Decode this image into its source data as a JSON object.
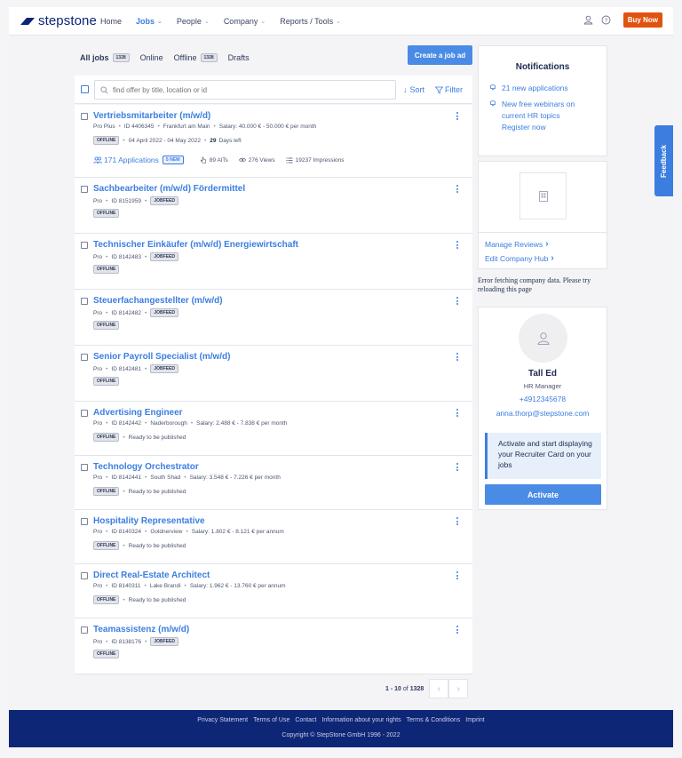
{
  "header": {
    "logo_text": "stepstone",
    "nav": [
      {
        "label": "Home",
        "dropdown": false,
        "active": false
      },
      {
        "label": "Jobs",
        "dropdown": true,
        "active": true
      },
      {
        "label": "People",
        "dropdown": true,
        "active": false
      },
      {
        "label": "Company",
        "dropdown": true,
        "active": false
      },
      {
        "label": "Reports / Tools",
        "dropdown": true,
        "active": false
      }
    ],
    "buy_label": "Buy Now",
    "accent": "#3b7ee0",
    "buy_color": "#e0530f"
  },
  "tabs": [
    {
      "label": "All jobs",
      "count": "1328",
      "active": true
    },
    {
      "label": "Online",
      "count": null,
      "active": false
    },
    {
      "label": "Offline",
      "count": "1328",
      "active": false
    },
    {
      "label": "Drafts",
      "count": null,
      "active": false
    }
  ],
  "create_label": "Create a job ad",
  "search": {
    "placeholder": "find offer by title, location or id",
    "sort_label": "Sort",
    "filter_label": "Filter"
  },
  "jobs": [
    {
      "title": "Vertriebsmitarbeiter (m/w/d)",
      "meta": [
        "Pro Plus",
        "ID 4406345",
        "Frankfurt am Main",
        "Salary: 40.000 € - 50.000 € per month"
      ],
      "badge": null,
      "status_pill": "OFFLINE",
      "status_text": "04 April 2022 - 04 May 2022",
      "days_bold": "29",
      "days_text": "Days left",
      "applications": "171 Applications",
      "new_pill": "5 NEW",
      "alts": "89 AlTs",
      "views": "276 Views",
      "impressions": "19237 Impressions"
    },
    {
      "title": "Sachbearbeiter (m/w/d) Fördermittel",
      "meta": [
        "Pro",
        "ID 8151959"
      ],
      "badge": "JOBFEED",
      "status_pill": "OFFLINE",
      "status_text": ""
    },
    {
      "title": "Technischer Einkäufer (m/w/d) Energiewirtschaft",
      "meta": [
        "Pro",
        "ID 8142483"
      ],
      "badge": "JOBFEED",
      "status_pill": "OFFLINE",
      "status_text": ""
    },
    {
      "title": "Steuerfachangestellter (m/w/d)",
      "meta": [
        "Pro",
        "ID 8142482"
      ],
      "badge": "JOBFEED",
      "status_pill": "OFFLINE",
      "status_text": ""
    },
    {
      "title": "Senior Payroll Specialist (m/w/d)",
      "meta": [
        "Pro",
        "ID 8142481"
      ],
      "badge": "JOBFEED",
      "status_pill": "OFFLINE",
      "status_text": ""
    },
    {
      "title": "Advertising Engineer",
      "meta": [
        "Pro",
        "ID 8142442",
        "Naderborough",
        "Salary: 2.488 € - 7.838 € per month"
      ],
      "badge": null,
      "status_pill": "OFFLINE",
      "status_text": "Ready to be published"
    },
    {
      "title": "Technology Orchestrator",
      "meta": [
        "Pro",
        "ID 8142441",
        "South Shad",
        "Salary: 3.548 € - 7.226 € per month"
      ],
      "badge": null,
      "status_pill": "OFFLINE",
      "status_text": "Ready to be published"
    },
    {
      "title": "Hospitality Representative",
      "meta": [
        "Pro",
        "ID 8140324",
        "Goldnerview",
        "Salary: 1.802 € - 8.121 € per annum"
      ],
      "badge": null,
      "status_pill": "OFFLINE",
      "status_text": "Ready to be published"
    },
    {
      "title": "Direct Real-Estate Architect",
      "meta": [
        "Pro",
        "ID 8140311",
        "Lake Brandi",
        "Salary: 1.962 € - 13.760 € per annum"
      ],
      "badge": null,
      "status_pill": "OFFLINE",
      "status_text": "Ready to be published"
    },
    {
      "title": "Teamassistenz (m/w/d)",
      "meta": [
        "Pro",
        "ID 8138176"
      ],
      "badge": "JOBFEED",
      "status_pill": "OFFLINE",
      "status_text": ""
    }
  ],
  "pagination": {
    "range": "1 - 10",
    "of": "of",
    "total": "1328"
  },
  "notifications": {
    "title": "Notifications",
    "items": [
      "21 new applications",
      "New free webinars on current HR topics Register now"
    ]
  },
  "company": {
    "links": [
      "Manage Reviews",
      "Edit Company Hub"
    ],
    "error": "Error fetching company data. Please try reloading this page"
  },
  "recruiter": {
    "name": "Tall Ed",
    "role": "HR Manager",
    "phone": "+4912345678",
    "email": "anna.thorp@stepstone.com",
    "info": "Activate and start displaying your Recruiter Card on your jobs",
    "button": "Activate"
  },
  "feedback_label": "Feedback",
  "footer": {
    "links": [
      "Privacy Statement",
      "Terms of Use",
      "Contact",
      "Information about your rights",
      "Terms & Conditions",
      "Imprint"
    ],
    "copyright": "Copyright © StepStone GmbH 1996 - 2022"
  }
}
